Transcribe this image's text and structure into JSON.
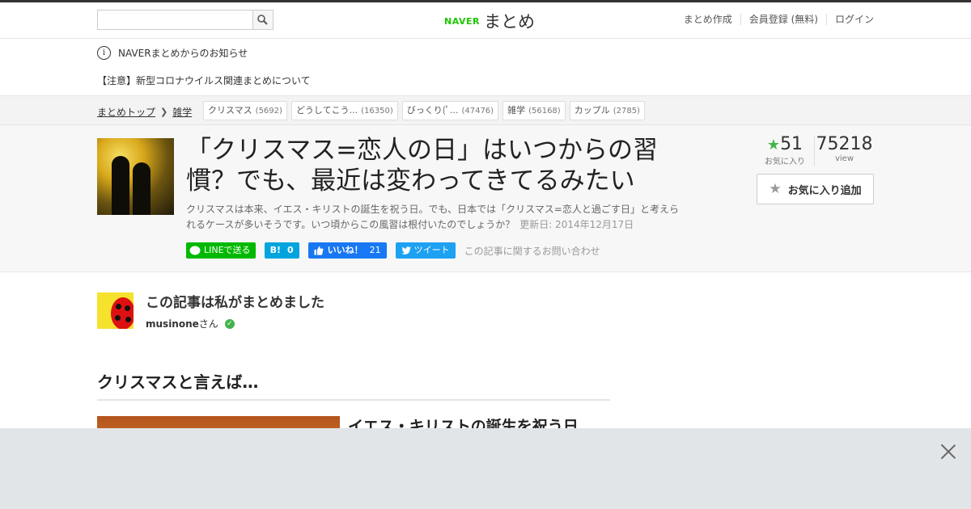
{
  "header": {
    "search_placeholder": "",
    "logo_naver": "NAVER",
    "logo_matome": "まとめ",
    "links": [
      "まとめ作成",
      "会員登録 (無料)",
      "ログイン"
    ]
  },
  "notice": {
    "title": "NAVERまとめからのお知らせ",
    "link": "【注意】新型コロナウイルス関連まとめについて"
  },
  "breadcrumb": {
    "items": [
      "まとめトップ",
      "雑学"
    ],
    "tags": [
      {
        "label": "クリスマス",
        "count": "(5692)"
      },
      {
        "label": "どうしてこう...",
        "count": "(16350)"
      },
      {
        "label": "びっくり(ﾟ...",
        "count": "(47476)"
      },
      {
        "label": "雑学",
        "count": "(56168)"
      },
      {
        "label": "カップル",
        "count": "(2785)"
      }
    ]
  },
  "article": {
    "title": "「クリスマス=恋人の日」はいつからの習慣？でも、最近は変わってきてるみたい",
    "description": "クリスマスは本来、イエス・キリストの誕生を祝う日。でも、日本では「クリスマス=恋人と過ごす日」と考えられるケースが多いそうです。いつ頃からこの風習は根付いたのでしょうか？",
    "updated": "更新日: 2014年12月17日",
    "share": {
      "line": "LINEで送る",
      "hatena_count": "0",
      "fb_label": "いいね！",
      "fb_count": "21",
      "tweet": "ツイート",
      "contact": "この記事に関するお問い合わせ"
    },
    "favorites": "51",
    "favorites_label": "お気に入り",
    "views": "75218",
    "views_label": "view",
    "fav_button": "お気に入り追加"
  },
  "curator": {
    "heading": "この記事は私がまとめました",
    "name": "musinone",
    "suffix": "さん"
  },
  "section": {
    "heading": "クリスマスと言えば…",
    "item_title": "イエス・キリストの誕生を祝う日"
  },
  "colors": {
    "accent": "#1ec800",
    "fav_star": "#43b34a",
    "line": "#00b900",
    "hatena": "#00a4de",
    "facebook": "#1877f2",
    "twitter": "#1da1f2"
  }
}
